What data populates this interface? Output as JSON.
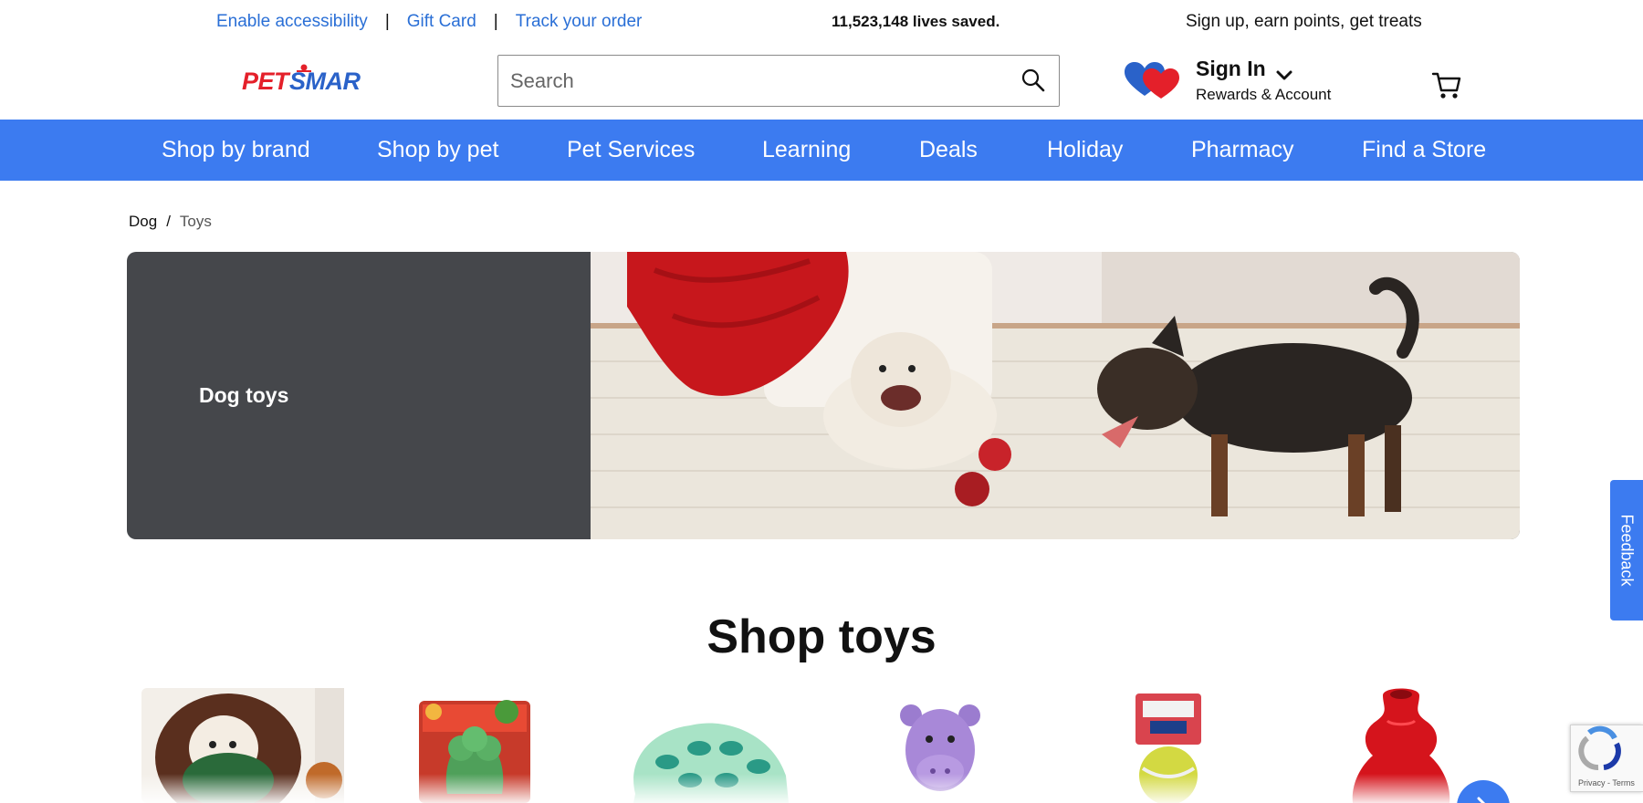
{
  "utility_bar": {
    "links": [
      "Enable accessibility",
      "Gift Card",
      "Track your order"
    ],
    "separator": "|",
    "lives_saved": "11,523,148 lives saved.",
    "promo": "Sign up, earn points, get treats"
  },
  "header": {
    "logo_text": "PETSMART",
    "search_placeholder": "Search",
    "signin_label": "Sign In",
    "rewards_label": "Rewards & Account"
  },
  "nav": {
    "items": [
      "Shop by brand",
      "Shop by pet",
      "Pet Services",
      "Learning",
      "Deals",
      "Holiday",
      "Pharmacy",
      "Find a Store"
    ]
  },
  "breadcrumb": {
    "items": [
      "Dog",
      "Toys"
    ],
    "separator": "/"
  },
  "hero": {
    "title": "Dog toys"
  },
  "shop": {
    "title": "Shop toys",
    "product_tiles": [
      {
        "icon": "spaniel-with-plush-toy"
      },
      {
        "icon": "broccoli-chew-toy"
      },
      {
        "icon": "puzzle-feeder-toy"
      },
      {
        "icon": "purple-hippo-plush"
      },
      {
        "icon": "kong-airdog-ball"
      },
      {
        "icon": "red-kong-classic"
      }
    ]
  },
  "feedback_label": "Feedback",
  "recaptcha_label": "Privacy - Terms",
  "colors": {
    "brand_blue": "#3c7bf0",
    "link_blue": "#2a6fd6",
    "hero_panel": "#45474b",
    "logo_red": "#e4202a",
    "logo_blue": "#2a62c9"
  }
}
